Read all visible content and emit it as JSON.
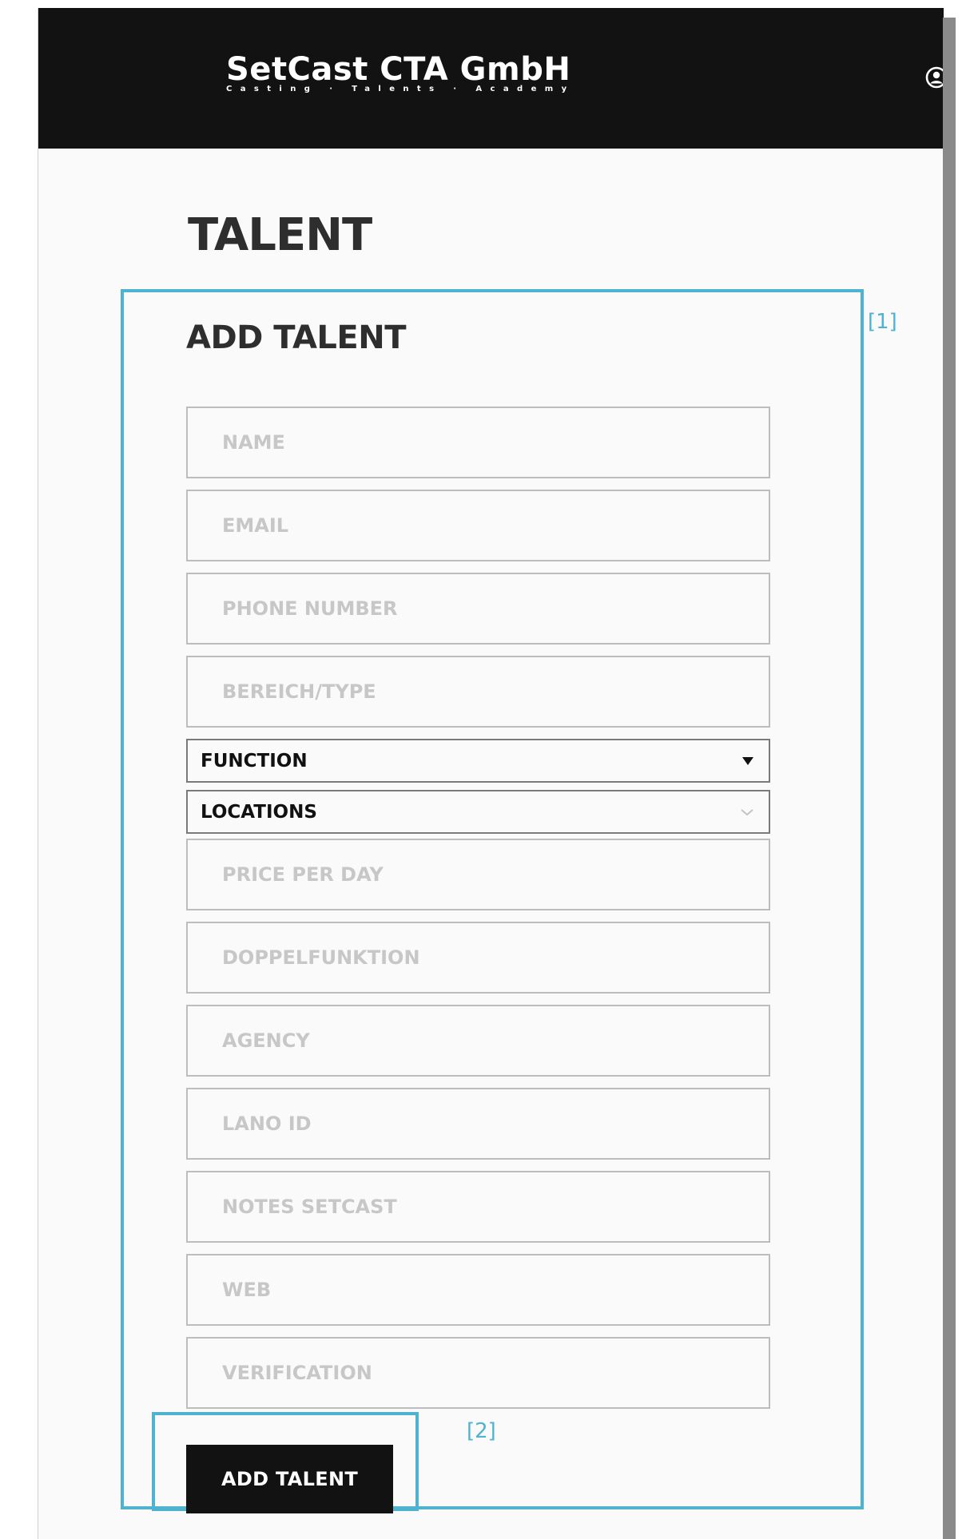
{
  "header": {
    "brand_name": "SetCast CTA GmbH",
    "brand_tagline": "Casting · Talents · Academy",
    "user_icon": "user-circle-icon"
  },
  "page": {
    "title": "TALENT"
  },
  "form": {
    "title": "ADD TALENT",
    "fields": {
      "name": "NAME",
      "email": "EMAIL",
      "phone": "PHONE NUMBER",
      "bereich_type": "BEREICH/TYPE",
      "function": "FUNCTION",
      "locations": "LOCATIONS",
      "price_per_day": "PRICE PER DAY",
      "doppelfunktion": "DOPPELFUNKTION",
      "agency": "AGENCY",
      "lano_id": "LANO ID",
      "notes_setcast": "NOTES SETCAST",
      "web": "WEB",
      "verification": "VERIFICATION"
    },
    "submit_label": "ADD TALENT"
  },
  "annotations": {
    "form_marker": "[1]",
    "button_marker": "[2]"
  },
  "colors": {
    "header_bg": "#121212",
    "annotation": "#4fb2cf",
    "page_bg": "#fafafa"
  }
}
